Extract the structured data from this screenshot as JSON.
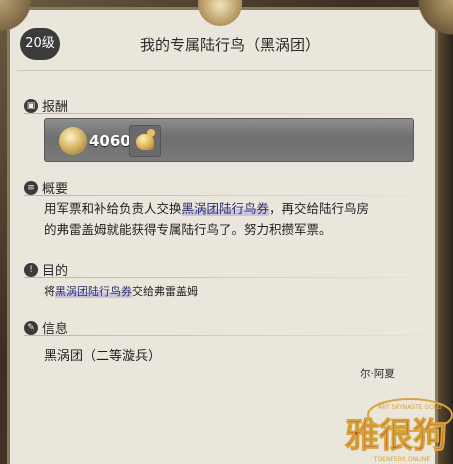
{
  "quest": {
    "level_badge": "20级",
    "title": "我的专属陆行鸟（黑涡团）"
  },
  "sections": {
    "reward": {
      "label": "报酬",
      "icon": "reward-icon"
    },
    "summary": {
      "label": "概要",
      "icon": "book-icon"
    },
    "objective": {
      "label": "目的",
      "icon": "exclamation-icon"
    },
    "info": {
      "label": "信息",
      "icon": "note-icon"
    }
  },
  "reward": {
    "seal_amount": "4060",
    "seal_icon": "company-seal-icon",
    "item_icon": "chocobo-icon"
  },
  "summary": {
    "line1_pre": "用军票和补给负责人交换",
    "line1_hl": "黑涡团陆行鸟券",
    "line1_post": "，再交给陆行鸟房",
    "line2": "的弗雷盖姆就能获得专属陆行鸟了。努力积攒军票。"
  },
  "objective": {
    "pre": "将",
    "hl": "黑涡团陆行鸟券",
    "post": "交给弗雷盖姆"
  },
  "info": {
    "text": "黑涡团（二等漩兵）",
    "npc": "尔·阿夏"
  },
  "watermark": {
    "top_text": "ART SKYNASTE GOLD",
    "main_text": "雅很狗",
    "bottom_text": "TOENFERS ONLINE"
  },
  "colors": {
    "paper": "#eae6dc",
    "badge": "#3b3b3b",
    "reward_bar": "#7a7a7a",
    "highlight_text": "#2d2d6e",
    "watermark_red": "#b8322a",
    "watermark_gold": "#d6a43c"
  }
}
